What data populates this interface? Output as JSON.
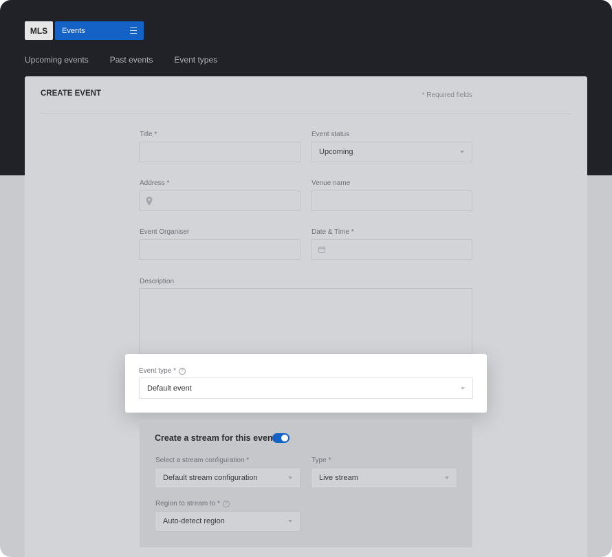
{
  "app": {
    "logo_label": "MLS",
    "section_label": "Events",
    "menu_icon": "hamburger-icon"
  },
  "nav": {
    "items": [
      "Upcoming events",
      "Past events",
      "Event types"
    ]
  },
  "form": {
    "title": "CREATE EVENT",
    "required_note": "* Required fields",
    "fields": {
      "title": {
        "label": "Title *",
        "value": ""
      },
      "event_status": {
        "label": "Event status",
        "value": "Upcoming"
      },
      "address": {
        "label": "Address *",
        "value": "",
        "icon": "map-pin-icon"
      },
      "venue_name": {
        "label": "Venue name",
        "value": ""
      },
      "organiser": {
        "label": "Event Organiser",
        "value": ""
      },
      "date_time": {
        "label": "Date & Time *",
        "value": "",
        "icon": "calendar-icon"
      },
      "description": {
        "label": "Description",
        "value": ""
      },
      "event_type": {
        "label": "Event type *",
        "value": "Default event",
        "help_icon": "help-circle-icon",
        "help_glyph": "?"
      }
    },
    "stream": {
      "title": "Create a stream for this event",
      "enabled": true,
      "config": {
        "label": "Select a stream configuration *",
        "value": "Default stream configuration"
      },
      "type": {
        "label": "Type *",
        "value": "Live stream"
      },
      "region": {
        "label": "Region to stream to *",
        "value": "Auto-detect region",
        "help_icon": "help-circle-icon",
        "help_glyph": "?"
      }
    }
  },
  "colors": {
    "header_bg": "#212227",
    "accent": "#1562c6",
    "page_bg": "#c9cacd",
    "card_bg": "#d3d4d7"
  }
}
